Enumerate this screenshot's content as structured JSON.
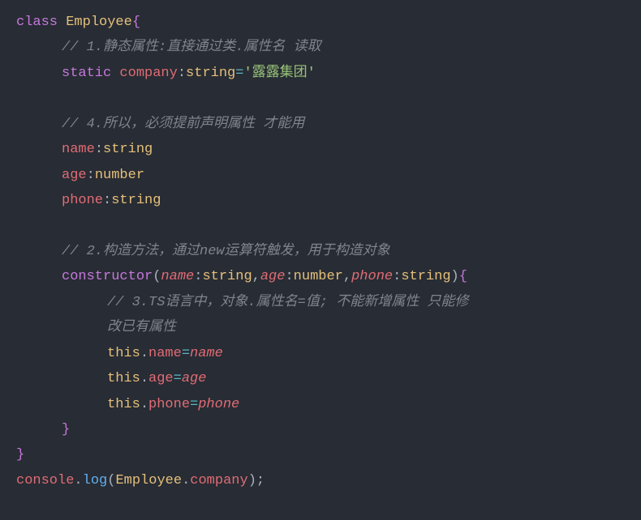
{
  "code": {
    "line1": {
      "class_kw": "class",
      "class_name": "Employee",
      "brace": "{"
    },
    "line2": {
      "comment": "// 1.静态属性:直接通过类.属性名 读取"
    },
    "line3": {
      "static_kw": "static",
      "prop": "company",
      "colon": ":",
      "type": "string",
      "eq": "=",
      "quote1": "'",
      "value": "露露集团",
      "quote2": "'"
    },
    "line5": {
      "comment": "// 4.所以，必须提前声明属性 才能用"
    },
    "line6": {
      "prop": "name",
      "colon": ":",
      "type": "string"
    },
    "line7": {
      "prop": "age",
      "colon": ":",
      "type": "number"
    },
    "line8": {
      "prop": "phone",
      "colon": ":",
      "type": "string"
    },
    "line10": {
      "comment": "// 2.构造方法，通过new运算符触发，用于构造对象"
    },
    "line11": {
      "constructor_kw": "constructor",
      "paren_open": "(",
      "p1": "name",
      "c1": ":",
      "t1": "string",
      "comma1": ",",
      "p2": "age",
      "c2": ":",
      "t2": "number",
      "comma2": ",",
      "p3": "phone",
      "c3": ":",
      "t3": "string",
      "paren_close": ")",
      "brace": "{"
    },
    "line12": {
      "comment_a": "// 3.TS语言中，对象.属性名=值; 不能新增属性 只能修",
      "comment_b": "改已有属性"
    },
    "line13": {
      "this_kw": "this",
      "dot": ".",
      "prop": "name",
      "eq": "=",
      "val": "name"
    },
    "line14": {
      "this_kw": "this",
      "dot": ".",
      "prop": "age",
      "eq": "=",
      "val": "age"
    },
    "line15": {
      "this_kw": "this",
      "dot": ".",
      "prop": "phone",
      "eq": "=",
      "val": "phone"
    },
    "line16": {
      "brace": "}"
    },
    "line17": {
      "brace": "}"
    },
    "line18": {
      "obj": "console",
      "dot": ".",
      "method": "log",
      "paren_open": "(",
      "cls": "Employee",
      "dot2": ".",
      "prop": "company",
      "paren_close": ")",
      "semi": ";"
    }
  }
}
